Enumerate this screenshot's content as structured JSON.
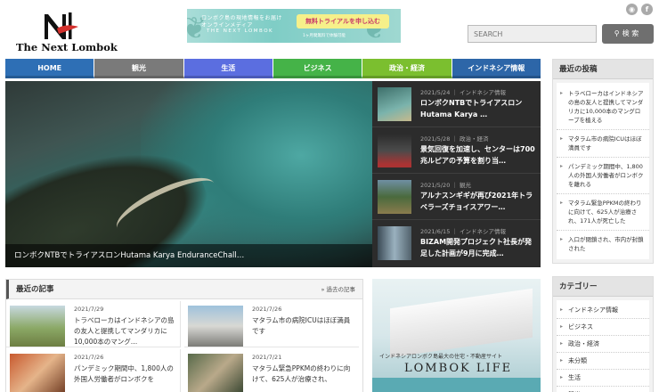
{
  "site": {
    "name": "The Next Lombok"
  },
  "banner": {
    "line1": "ロンボク島の現地情報をお届け",
    "line2": "オンラインメディア",
    "line3": "THE NEXT LOMBOK",
    "button": "無料トライアルを申し込む",
    "sub": "1ヶ月間無料で体験可能"
  },
  "search": {
    "placeholder": "SEARCH",
    "button": "検 索"
  },
  "nav": [
    {
      "label": "HOME",
      "color": "#2e6fb5"
    },
    {
      "label": "観光",
      "color": "#7a7a7a"
    },
    {
      "label": "生活",
      "color": "#5b6ee0"
    },
    {
      "label": "ビジネス",
      "color": "#45b348"
    },
    {
      "label": "政治・経済",
      "color": "#7bbf2f"
    },
    {
      "label": "インドネシア情報",
      "color": "#2d66a8"
    }
  ],
  "hero": {
    "caption": "ロンボクNTBでトライアスロンHutama Karya EnduranceChall…",
    "items": [
      {
        "meta": "2021/5/24 ｜ インドネシア情報",
        "title": "ロンボクNTBでトライアスロン Hutama Karya …"
      },
      {
        "meta": "2021/5/28 ｜ 政治・経済",
        "title": "景気回復を加速し、センターは700兆ルピアの予算を割り当…"
      },
      {
        "meta": "2021/5/20 ｜ 観光",
        "title": "アルナスンギギが再び2021年トラベラーズチョイスアワー…"
      },
      {
        "meta": "2021/6/15 ｜ インドネシア情報",
        "title": "BIZAM開発プロジェクト社長が発足した計画が9月に完成…"
      }
    ]
  },
  "recent": {
    "title": "最近の記事",
    "more": "» 過去の記事",
    "items": [
      {
        "date": "2021/7/29",
        "text": "トラベローカはインドネシアの島の友人と提携してマンダリカに10,000本のマング…"
      },
      {
        "date": "2021/7/26",
        "text": "マタラム市の病院ICUはほぼ満員です"
      },
      {
        "date": "2021/7/26",
        "text": "パンデミック期間中、1,800人の外国人労働者がロンボクを"
      },
      {
        "date": "2021/7/21",
        "text": "マタラム緊急PPKMの終わりに向けて、625人が治療され、"
      }
    ]
  },
  "ad": {
    "sub": "インドネシアロンボク島最大の住宅・不動産サイト",
    "title": "LOMBOK LIFE"
  },
  "sidebar": {
    "posts_title": "最近の投稿",
    "posts": [
      "トラベローカはインドネシアの島の友人と提携してマンダリカに10,000本のマングローブを植える",
      "マタラム市の病院ICUはほぼ満員です",
      "パンデミック期間中、1,800人の外国人労働者がロンボクを離れる",
      "マタラム緊急PPKMの終わりに向けて、625人が治療され、171人が死亡した",
      "入口が閉鎖され、市内が封鎖された"
    ],
    "cats_title": "カテゴリー",
    "cats": [
      "インドネシア情報",
      "ビジネス",
      "政治・経済",
      "未分類",
      "生活",
      "観光"
    ]
  }
}
